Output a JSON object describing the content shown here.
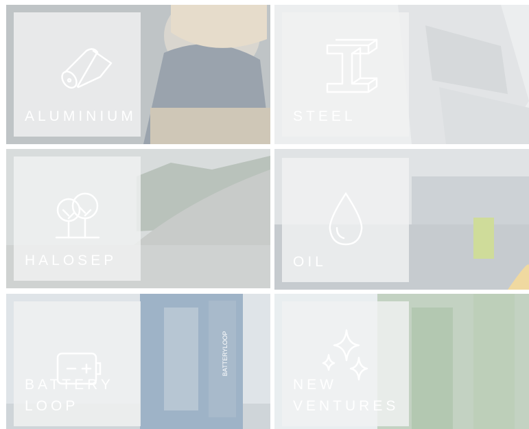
{
  "tiles": [
    {
      "key": "aluminium",
      "label": "ALUMINIUM",
      "icon": "foil-roll-icon"
    },
    {
      "key": "steel",
      "label": "STEEL",
      "icon": "steel-beam-icon"
    },
    {
      "key": "halosep",
      "label": "HALOSEP",
      "icon": "trees-icon"
    },
    {
      "key": "oil",
      "label": "OIL",
      "icon": "oil-drop-icon"
    },
    {
      "key": "battery_loop",
      "label": "BATTERY\nLOOP",
      "icon": "battery-icon"
    },
    {
      "key": "new_ventures",
      "label": "NEW\nVENTURES",
      "icon": "sparkle-icon"
    }
  ],
  "container_text": "BATTERYLOOP",
  "colors": {
    "card": "#f0f1f2",
    "label": "#ffffff",
    "icon_stroke": "#ffffff"
  }
}
